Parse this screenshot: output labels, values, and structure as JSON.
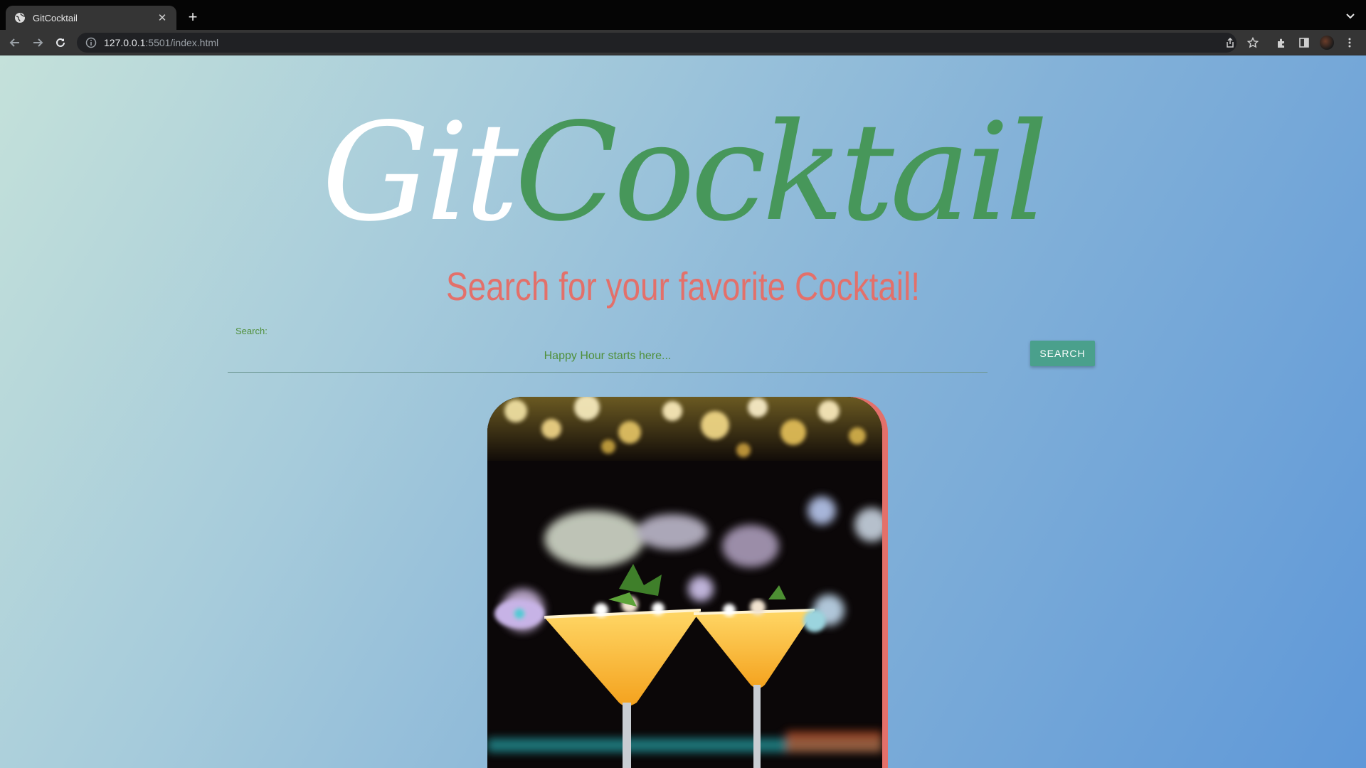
{
  "browser": {
    "tab_title": "GitCocktail",
    "url_host": "127.0.0.1",
    "url_rest": ":5501/index.html"
  },
  "page": {
    "logo_part1": "Git",
    "logo_part2": "Cocktail",
    "tagline": "Search for your favorite Cocktail!",
    "search_label": "Search:",
    "search_placeholder": "Happy Hour starts here...",
    "search_button": "SEARCH"
  },
  "colors": {
    "logo_green": "#47975a",
    "tagline_coral": "#e3706a",
    "button_teal": "#4aa08c"
  },
  "icons": [
    "globe-icon",
    "close-icon",
    "plus-icon",
    "chevron-down-icon",
    "back-icon",
    "forward-icon",
    "reload-icon",
    "info-icon",
    "share-icon",
    "star-icon",
    "extensions-icon",
    "side-panel-icon",
    "menu-icon"
  ]
}
